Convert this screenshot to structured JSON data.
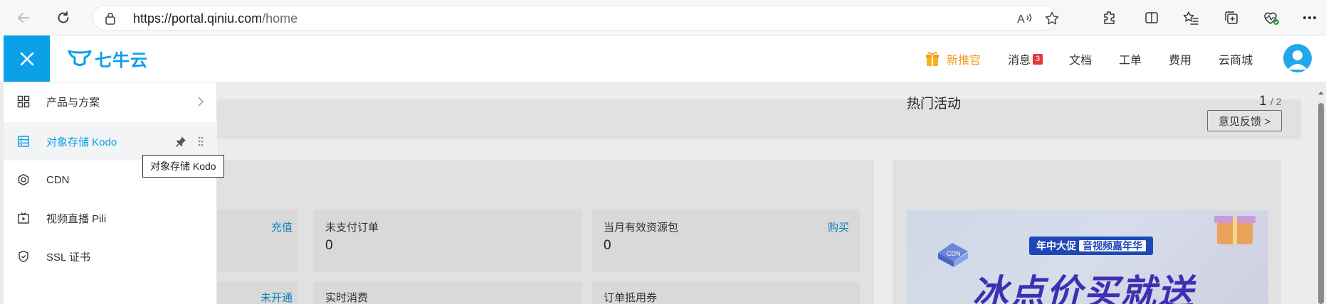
{
  "browser": {
    "url_host": "https://portal.qiniu.com",
    "url_path": "/home"
  },
  "header": {
    "logo_text": "七牛云",
    "nav": {
      "promo": "新推官",
      "messages": "消息",
      "messages_count": "3",
      "docs": "文档",
      "tickets": "工单",
      "billing": "费用",
      "market": "云商城"
    }
  },
  "sidebar": {
    "items": [
      {
        "label": "产品与方案",
        "icon": "grid-icon"
      },
      {
        "label": "对象存储 Kodo",
        "icon": "storage-icon"
      },
      {
        "label": "CDN",
        "icon": "cdn-icon"
      },
      {
        "label": "视频直播 Pili",
        "icon": "live-video-icon"
      },
      {
        "label": "SSL 证书",
        "icon": "shield-icon"
      }
    ],
    "tooltip": "对象存储 Kodo"
  },
  "main": {
    "feedback_button": "意见反馈 >",
    "cards": {
      "recharge_link": "充值",
      "unpaid_orders_title": "未支付订单",
      "unpaid_orders_value": "0",
      "resource_packs_title": "当月有效资源包",
      "resource_packs_value": "0",
      "buy_link": "购买",
      "not_enabled_link": "未开通",
      "realtime_title": "实时消费",
      "coupon_title": "订单抵用券"
    },
    "hot_activities": {
      "title": "热门活动",
      "page_current": "1",
      "page_total": "/ 2",
      "banner_tag": "年中大促",
      "banner_tag_sub": "音视频嘉年华",
      "banner_headline": "冰点价买就送"
    }
  },
  "colors": {
    "brand": "#0aa0e8",
    "promo": "#f39b1a",
    "badge": "#e23a3a",
    "link": "#0f82b8"
  }
}
